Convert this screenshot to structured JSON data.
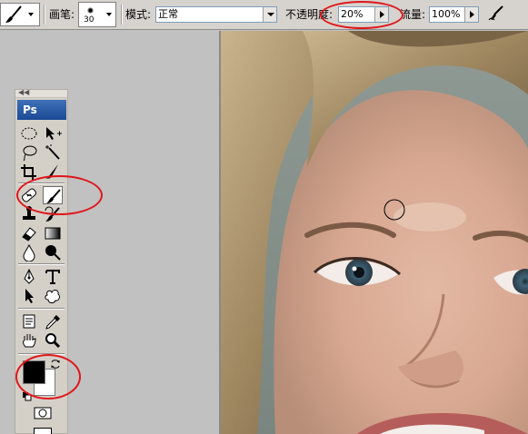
{
  "options_bar": {
    "brush_label": "画笔:",
    "brush_size": "30",
    "mode_label": "模式:",
    "mode_value": "正常",
    "opacity_label": "不透明度:",
    "opacity_value": "20%",
    "flow_label": "流量:",
    "flow_value": "100%"
  },
  "toolbox": {
    "logo_text": "Ps",
    "grip_text": "◀◀",
    "tools": [
      "marquee-tool",
      "move-tool",
      "lasso-tool",
      "magic-wand-tool",
      "crop-tool",
      "slice-tool",
      "healing-brush-tool",
      "brush-tool",
      "clone-stamp-tool",
      "history-brush-tool",
      "eraser-tool",
      "gradient-tool",
      "blur-tool",
      "dodge-tool",
      "pen-tool",
      "type-tool",
      "path-selection-tool",
      "custom-shape-tool",
      "notes-tool",
      "eyedropper-tool",
      "hand-tool",
      "zoom-tool"
    ],
    "foreground_color": "#000000",
    "background_color": "#ffffff"
  },
  "highlights": {
    "color": "#e0161b"
  },
  "canvas": {
    "image_description_free": true
  }
}
